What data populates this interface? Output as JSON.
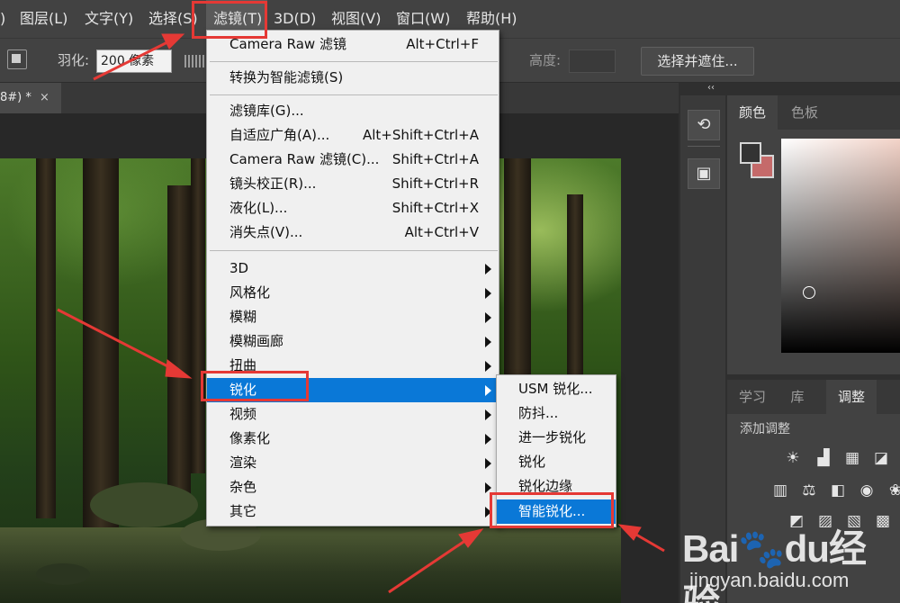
{
  "menubar": {
    "items": [
      {
        "label": ")"
      },
      {
        "label": "图层(L)"
      },
      {
        "label": "文字(Y)"
      },
      {
        "label": "选择(S)"
      },
      {
        "label": "滤镜(T)"
      },
      {
        "label": "3D(D)"
      },
      {
        "label": "视图(V)"
      },
      {
        "label": "窗口(W)"
      },
      {
        "label": "帮助(H)"
      }
    ]
  },
  "options": {
    "feather_label": "羽化:",
    "feather_value": "200 像素",
    "height_label": "高度:",
    "select_mask_label": "选择并遮住..."
  },
  "document_tab": {
    "name": "8#) *",
    "close": "×"
  },
  "filter_menu": {
    "items": [
      {
        "label": "Camera Raw 滤镜",
        "shortcut": "Alt+Ctrl+F"
      },
      {
        "label": "转换为智能滤镜(S)",
        "shortcut": ""
      },
      {
        "label": "滤镜库(G)...",
        "shortcut": ""
      },
      {
        "label": "自适应广角(A)...",
        "shortcut": "Alt+Shift+Ctrl+A"
      },
      {
        "label": "Camera Raw 滤镜(C)...",
        "shortcut": "Shift+Ctrl+A"
      },
      {
        "label": "镜头校正(R)...",
        "shortcut": "Shift+Ctrl+R"
      },
      {
        "label": "液化(L)...",
        "shortcut": "Shift+Ctrl+X"
      },
      {
        "label": "消失点(V)...",
        "shortcut": "Alt+Ctrl+V"
      },
      {
        "label": "3D"
      },
      {
        "label": "风格化"
      },
      {
        "label": "模糊"
      },
      {
        "label": "模糊画廊"
      },
      {
        "label": "扭曲"
      },
      {
        "label": "锐化"
      },
      {
        "label": "视频"
      },
      {
        "label": "像素化"
      },
      {
        "label": "渲染"
      },
      {
        "label": "杂色"
      },
      {
        "label": "其它"
      }
    ]
  },
  "sharpen_submenu": {
    "items": [
      {
        "label": "USM 锐化..."
      },
      {
        "label": "防抖..."
      },
      {
        "label": "进一步锐化"
      },
      {
        "label": "锐化"
      },
      {
        "label": "锐化边缘"
      },
      {
        "label": "智能锐化..."
      }
    ]
  },
  "color_panel": {
    "tabs": [
      {
        "label": "颜色"
      },
      {
        "label": "色板"
      }
    ],
    "fg_color": "#333333",
    "bg_color": "#c56a6a"
  },
  "adjust_panel": {
    "tabs": [
      {
        "label": "学习"
      },
      {
        "label": "库"
      },
      {
        "label": "调整"
      }
    ],
    "title": "添加调整"
  },
  "collapse": "‹‹",
  "watermark": {
    "logo": "Bai🐾du经验",
    "url": "jingyan.baidu.com"
  },
  "colors": {
    "highlight": "#0a78d7",
    "annotation": "#e53935"
  }
}
